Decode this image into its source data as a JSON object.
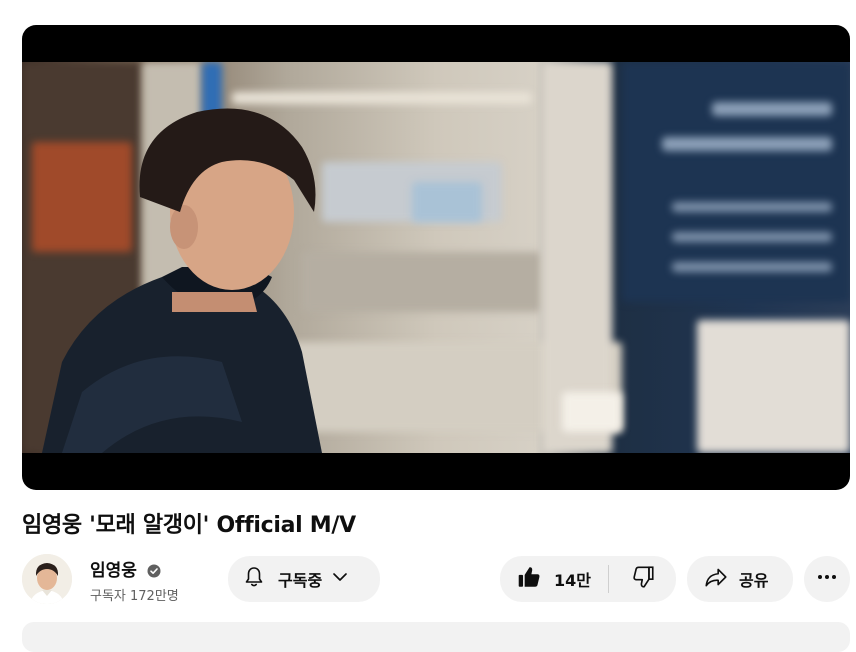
{
  "video": {
    "title": "임영웅 '모래 알갱이' Official M/V"
  },
  "channel": {
    "name": "임영웅",
    "subscribers": "구독자 172만명",
    "verified": true
  },
  "actions": {
    "subscribe_label": "구독중",
    "like_count": "14만",
    "share_label": "공유"
  },
  "icons": [
    "verified-badge-icon",
    "bell-icon",
    "chevron-down-icon",
    "thumbs-up-icon",
    "thumbs-down-icon",
    "share-icon",
    "more-icon"
  ],
  "colors": {
    "background": "#ffffff",
    "text": "#0f0f0f",
    "secondary_text": "#606060",
    "button_bg": "#f2f2f2"
  }
}
